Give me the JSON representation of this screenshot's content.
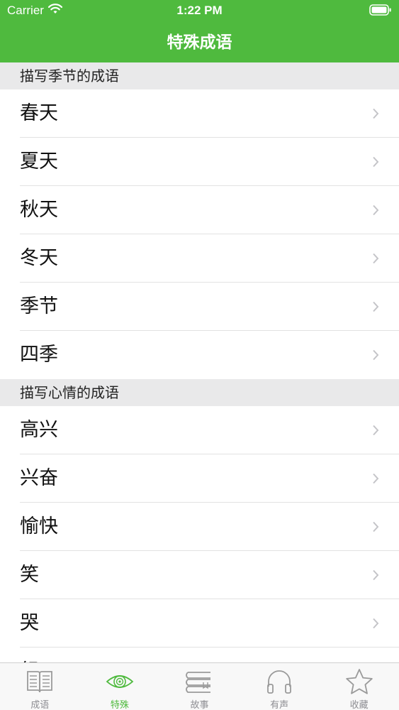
{
  "status": {
    "carrier": "Carrier",
    "time": "1:22 PM"
  },
  "nav": {
    "title": "特殊成语"
  },
  "sections": [
    {
      "title": "描写季节的成语",
      "items": [
        "春天",
        "夏天",
        "秋天",
        "冬天",
        "季节",
        "四季"
      ]
    },
    {
      "title": "描写心情的成语",
      "items": [
        "高兴",
        "兴奋",
        "愉快",
        "笑",
        "哭",
        "怒"
      ]
    }
  ],
  "tabs": [
    {
      "label": "成语",
      "icon": "book-icon",
      "active": false
    },
    {
      "label": "特殊",
      "icon": "eye-icon",
      "active": true
    },
    {
      "label": "故事",
      "icon": "books-stack-icon",
      "active": false
    },
    {
      "label": "有声",
      "icon": "headphones-icon",
      "active": false
    },
    {
      "label": "收藏",
      "icon": "star-icon",
      "active": false
    }
  ],
  "colors": {
    "accent": "#4fba3e",
    "section_bg": "#e9e9ea",
    "tab_inactive": "#8e8e93"
  }
}
